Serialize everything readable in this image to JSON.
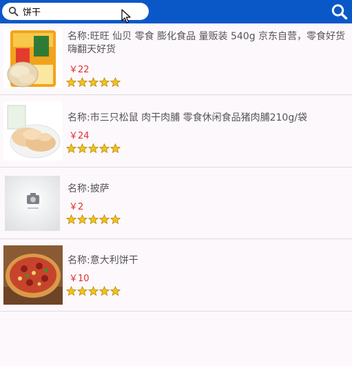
{
  "search": {
    "value": "饼干",
    "icon": "search-icon",
    "button_icon": "search-icon"
  },
  "colors": {
    "topbar": "#0a58c8",
    "price": "#e0302e",
    "star": "#f3c21b"
  },
  "products": [
    {
      "name": "名称:旺旺 仙贝 零食 膨化食品 量贩装 540g 京东自营，零食好货嗨翻天好货",
      "price": "￥22",
      "rating": 5,
      "image": "rice-cracker-bag-image"
    },
    {
      "name": "名称:市三只松鼠 肉干肉脯 零食休闲食品猪肉脯210g/袋",
      "price": "￥24",
      "rating": 5,
      "image": "pork-jerky-image"
    },
    {
      "name": "名称:披萨",
      "price": "￥2",
      "rating": 5,
      "image": "placeholder-image"
    },
    {
      "name": "名称:意大利饼干",
      "price": "￥10",
      "rating": 5,
      "image": "pizza-image"
    }
  ]
}
